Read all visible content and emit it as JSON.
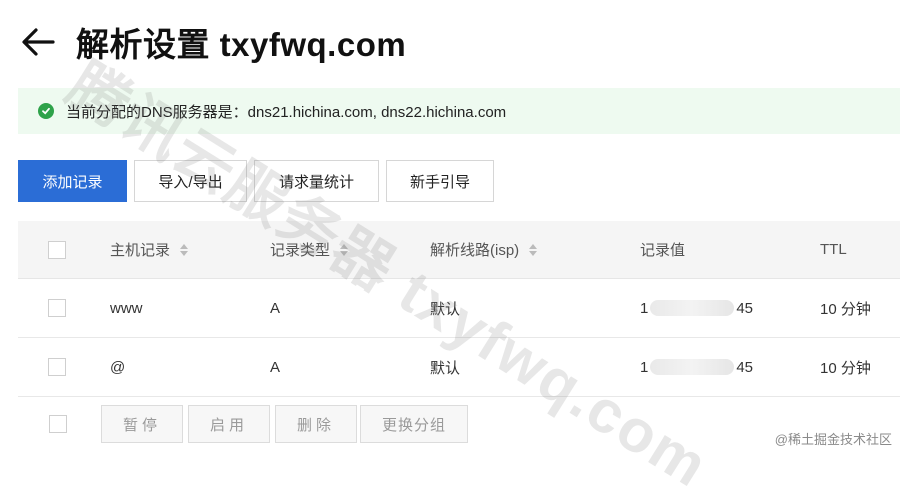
{
  "header": {
    "title": "解析设置 txyfwq.com"
  },
  "notice": {
    "text": "当前分配的DNS服务器是：dns21.hichina.com, dns22.hichina.com",
    "color": "#2ea24a"
  },
  "toolbar": {
    "add": "添加记录",
    "import": "导入/导出",
    "stats": "请求量统计",
    "guide": "新手引导"
  },
  "table": {
    "headers": {
      "host": "主机记录",
      "type": "记录类型",
      "line": "解析线路(isp)",
      "value": "记录值",
      "ttl": "TTL"
    },
    "rows": [
      {
        "host": "www",
        "type": "A",
        "line": "默认",
        "value_prefix": "1",
        "value_suffix": "45",
        "ttl": "10 分钟"
      },
      {
        "host": "@",
        "type": "A",
        "line": "默认",
        "value_prefix": "1",
        "value_suffix": "45",
        "ttl": "10 分钟"
      }
    ]
  },
  "bulk": {
    "pause": "暂停",
    "enable": "启用",
    "delete": "删除",
    "group": "更换分组"
  },
  "watermark": "腾讯云服务器 txyfwq.com",
  "credit": "@稀土掘金技术社区",
  "colors": {
    "primary": "#2b6dd6",
    "notice_bg": "#eefaf0"
  }
}
